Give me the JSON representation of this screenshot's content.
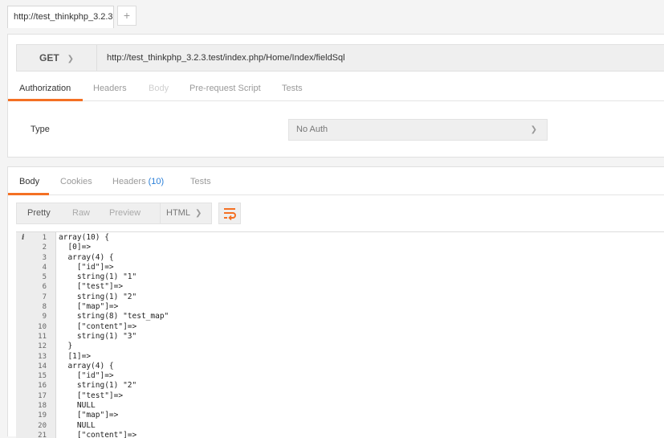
{
  "tabs": [
    {
      "label": "http://test_thinkphp_3.2.3"
    }
  ],
  "new_tab_label": "+",
  "request": {
    "method": "GET",
    "url": "http://test_thinkphp_3.2.3.test/index.php/Home/Index/fieldSql",
    "tabs": [
      "Authorization",
      "Headers",
      "Body",
      "Pre-request Script",
      "Tests"
    ],
    "auth": {
      "type_label": "Type",
      "type_value": "No Auth"
    }
  },
  "response": {
    "tabs": [
      "Body",
      "Cookies",
      "Headers",
      "Tests"
    ],
    "headers_count": "(10)",
    "view_modes": [
      "Pretty",
      "Raw",
      "Preview"
    ],
    "format": "HTML",
    "info_marker": "i",
    "code_lines": [
      "array(10) {",
      "  [0]=>",
      "  array(4) {",
      "    [\"id\"]=>",
      "    string(1) \"1\"",
      "    [\"test\"]=>",
      "    string(1) \"2\"",
      "    [\"map\"]=>",
      "    string(8) \"test_map\"",
      "    [\"content\"]=>",
      "    string(1) \"3\"",
      "  }",
      "  [1]=>",
      "  array(4) {",
      "    [\"id\"]=>",
      "    string(1) \"2\"",
      "    [\"test\"]=>",
      "    NULL",
      "    [\"map\"]=>",
      "    NULL",
      "    [\"content\"]=>"
    ]
  },
  "colors": {
    "accent": "#f47023",
    "link": "#2a7fd8"
  }
}
